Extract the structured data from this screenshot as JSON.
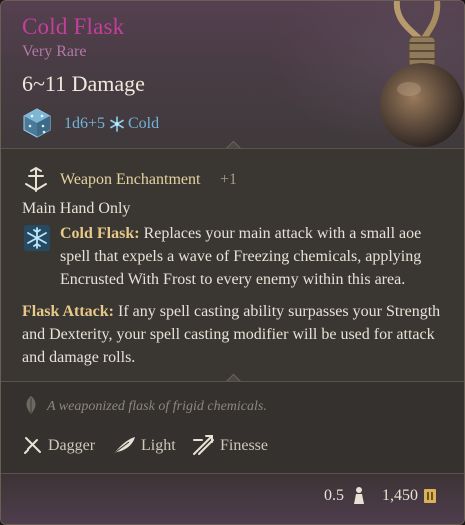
{
  "item": {
    "name": "Cold Flask",
    "rarity": "Very Rare",
    "damage": "6~11 Damage",
    "damage_formula": "1d6+5",
    "damage_type": "Cold",
    "damage_type_icon": "snowflake-icon",
    "dice_icon": "dice-icon",
    "image": "flask-icon"
  },
  "enchantment": {
    "label": "Weapon Enchantment",
    "value": "+1"
  },
  "restriction": "Main Hand Only",
  "abilities": [
    {
      "name": "Cold Flask:",
      "text": " Replaces your main attack with a small aoe spell that expels a wave of Freezing chemicals, applying Encrusted With Frost to every enemy within this area."
    },
    {
      "name": "Flask Attack:",
      "text": " If any spell casting ability surpasses your Strength and Dexterity, your spell casting modifier will be used for attack and damage rolls."
    }
  ],
  "flavor_text": "A weaponized flask of frigid chemicals.",
  "properties": [
    {
      "label": "Dagger",
      "icon": "dagger-icon"
    },
    {
      "label": "Light",
      "icon": "feather-icon"
    },
    {
      "label": "Finesse",
      "icon": "finesse-icon"
    }
  ],
  "footer": {
    "weight": "0.5",
    "price": "1,450"
  },
  "colors": {
    "title": "#c43f9b",
    "rarity": "#b07aa7",
    "cold": "#72b3d8",
    "keyword": "#e8c98a"
  }
}
